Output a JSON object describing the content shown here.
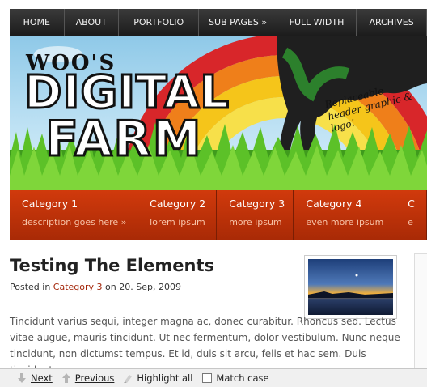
{
  "nav": {
    "items": [
      {
        "label": "HOME",
        "w": 70
      },
      {
        "label": "ABOUT",
        "w": 70
      },
      {
        "label": "PORTFOLIO",
        "w": 103
      },
      {
        "label": "SUB PAGES »",
        "w": 100
      },
      {
        "label": "FULL WIDTH",
        "w": 102
      },
      {
        "label": "ARCHIVES",
        "w": 90
      }
    ]
  },
  "header": {
    "logo_line1": "WOO'S",
    "logo_line2": "DIGITAL",
    "logo_line3": "FARM",
    "tagline": "Replaceable header graphic & logo!"
  },
  "categories": [
    {
      "title": "Category 1",
      "desc": "description goes here »"
    },
    {
      "title": "Category 2",
      "desc": "lorem ipsum"
    },
    {
      "title": "Category 3",
      "desc": "more ipsum"
    },
    {
      "title": "Category 4",
      "desc": "even more ipsum"
    },
    {
      "title": "C",
      "desc": "e"
    }
  ],
  "post": {
    "title": "Testing The Elements",
    "posted_in": "Posted in",
    "category": "Category 3",
    "on": "on 20. Sep, 2009",
    "body": "Tincidunt varius sequi, integer magna ac, donec curabitur. Rhoncus sed. Lectus vitae augue, mauris tincidunt. Ut nec fermentum, dolor vestibulum. Nunc neque tincidunt, non dictumst tempus. Et id, duis sit arcu, felis et hac sem. Duis tincidunt."
  },
  "findbar": {
    "next": "Next",
    "previous": "Previous",
    "highlight": "Highlight all",
    "match_case": "Match case"
  }
}
